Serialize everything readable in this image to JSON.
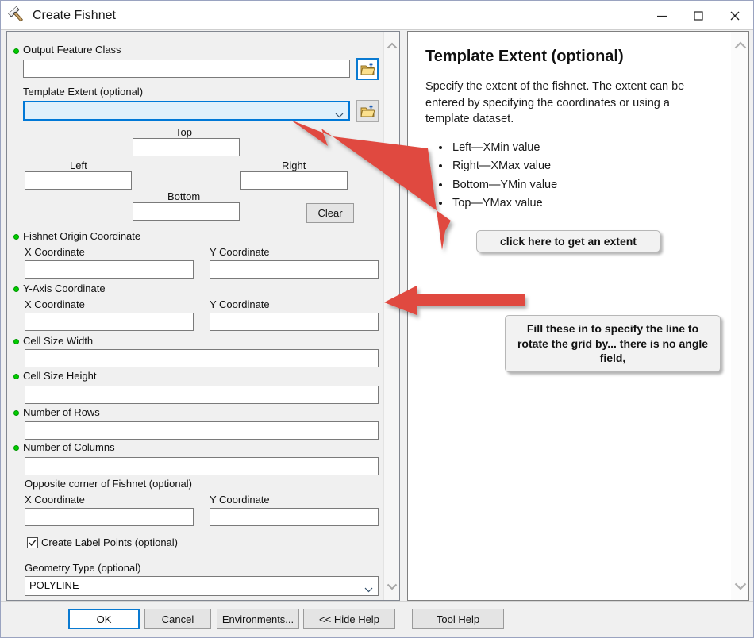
{
  "window": {
    "title": "Create Fishnet",
    "icon": "hammer-icon",
    "minimize_label": "Minimize",
    "maximize_label": "Maximize",
    "close_label": "Close"
  },
  "form": {
    "output_feature_class": {
      "label": "Output Feature Class",
      "value": "",
      "required": true
    },
    "template_extent": {
      "label": "Template Extent (optional)",
      "value": "",
      "required": false
    },
    "extent": {
      "top_label": "Top",
      "top_value": "",
      "left_label": "Left",
      "left_value": "",
      "right_label": "Right",
      "right_value": "",
      "bottom_label": "Bottom",
      "bottom_value": "",
      "clear_label": "Clear"
    },
    "fishnet_origin": {
      "label": "Fishnet Origin Coordinate",
      "x_label": "X Coordinate",
      "x_value": "",
      "y_label": "Y Coordinate",
      "y_value": "",
      "required": true
    },
    "y_axis": {
      "label": "Y-Axis Coordinate",
      "x_label": "X Coordinate",
      "x_value": "",
      "y_label": "Y Coordinate",
      "y_value": "",
      "required": true
    },
    "cell_size_width": {
      "label": "Cell Size Width",
      "value": "",
      "required": true
    },
    "cell_size_height": {
      "label": "Cell Size Height",
      "value": "",
      "required": true
    },
    "number_of_rows": {
      "label": "Number of Rows",
      "value": "",
      "required": true
    },
    "number_of_columns": {
      "label": "Number of Columns",
      "value": "",
      "required": true
    },
    "opposite_corner": {
      "label": "Opposite corner of Fishnet (optional)",
      "x_label": "X Coordinate",
      "x_value": "",
      "y_label": "Y Coordinate",
      "y_value": ""
    },
    "create_label_points": {
      "label": "Create Label Points (optional)",
      "checked": true
    },
    "geometry_type": {
      "label": "Geometry Type (optional)",
      "value": "POLYLINE"
    }
  },
  "help": {
    "title": "Template Extent (optional)",
    "body": "Specify the extent of the fishnet. The extent can be entered by specifying the coordinates or using a template dataset.",
    "bullets": [
      "Left—XMin value",
      "Right—XMax value",
      "Bottom—YMin value",
      "Top—YMax value"
    ]
  },
  "annotations": {
    "callout_extent": "click here   to get an extent",
    "callout_rotate": "Fill these in to specify the line to rotate the grid by... there is no angle field,",
    "arrow_color": "#e04a3f"
  },
  "footer": {
    "ok": "OK",
    "cancel": "Cancel",
    "environments": "Environments...",
    "hide_help": "<< Hide Help",
    "tool_help": "Tool Help"
  },
  "colors": {
    "dialog_bg": "#f0f0f0",
    "focus_blue": "#0a7ad1",
    "required_dot": "#00cc00",
    "annotation_red": "#e04a3f"
  }
}
